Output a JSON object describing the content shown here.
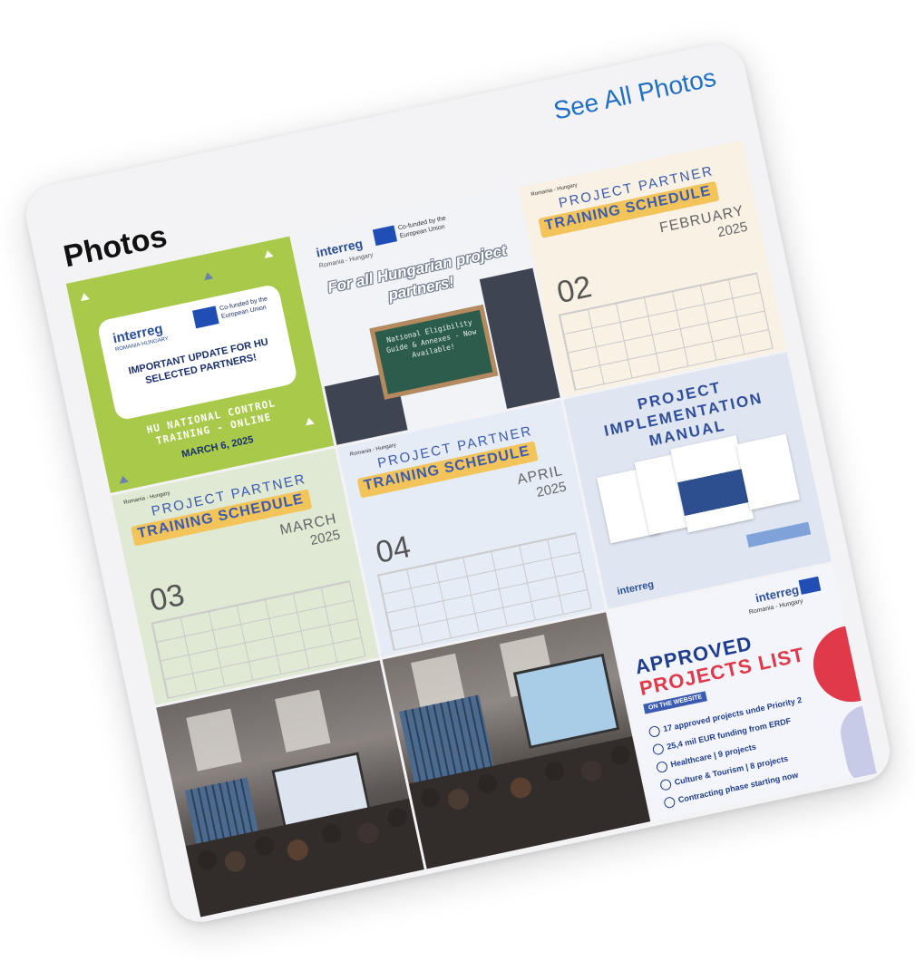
{
  "header": {
    "title": "Photos",
    "see_all": "See All Photos"
  },
  "tiles": {
    "t1": {
      "logo": "interreg",
      "eu_text": "Co-funded by the European Union",
      "region": "ROMANIA-HUNGARY",
      "headline": "IMPORTANT UPDATE FOR HU SELECTED PARTNERS!",
      "sub": "HU NATIONAL CONTROL TRAINING - ONLINE",
      "date": "MARCH 6, 2025"
    },
    "t2": {
      "logo": "interreg",
      "eu_text": "Co-funded by the European Union",
      "region": "Romania - Hungary",
      "headline": "For all Hungarian project partners!",
      "board": "National Eligibility Guide & Annexes - Now Available!"
    },
    "t3": {
      "region": "Romania - Hungary",
      "pp": "PROJECT PARTNER",
      "ts": "TRAINING SCHEDULE",
      "month": "FEBRUARY",
      "year": "2025",
      "num": "02"
    },
    "t4": {
      "headline": "PROJECT IMPLEMENTATION MANUAL",
      "logo": "interreg"
    },
    "t5": {
      "region": "Romania - Hungary",
      "pp": "PROJECT PARTNER",
      "ts": "TRAINING SCHEDULE",
      "month": "MARCH",
      "year": "2025",
      "num": "03"
    },
    "t6": {
      "region": "Romania - Hungary",
      "pp": "PROJECT PARTNER",
      "ts": "TRAINING SCHEDULE",
      "month": "APRIL",
      "year": "2025",
      "num": "04"
    },
    "t9": {
      "logo": "interreg",
      "region": "Romania - Hungary",
      "ap1": "APPROVED",
      "ap2": "PROJECTS LIST",
      "website": "ON THE WEBSITE",
      "items": [
        "17 approved projects unde Priority 2",
        "25,4 mil EUR funding from ERDF",
        "Healthcare | 9 projects",
        "Culture & Tourism | 8 projects",
        "Contracting phase starting now"
      ]
    }
  },
  "colors": {
    "accent": "#1f6fc7",
    "interreg_blue": "#2a4f9b",
    "green_tile": "#a8c94a",
    "schedule_yellow": "#f3c45a",
    "approved_red": "#e0394a"
  }
}
